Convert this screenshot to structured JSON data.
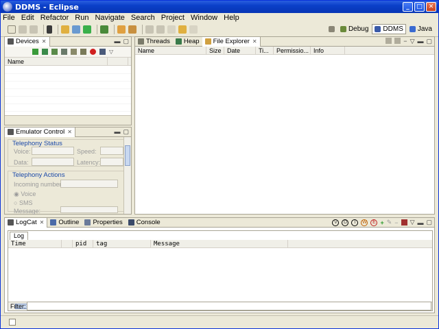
{
  "window": {
    "title": "DDMS - Eclipse"
  },
  "menu": [
    "File",
    "Edit",
    "Refactor",
    "Run",
    "Navigate",
    "Search",
    "Project",
    "Window",
    "Help"
  ],
  "perspectives": [
    {
      "label": "Debug",
      "active": false
    },
    {
      "label": "DDMS",
      "active": true
    },
    {
      "label": "Java",
      "active": false
    }
  ],
  "devices": {
    "tab": "Devices",
    "column": "Name"
  },
  "emulator": {
    "tab": "Emulator Control",
    "telephony_status": "Telephony Status",
    "voice_label": "Voice:",
    "speed_label": "Speed:",
    "data_label": "Data:",
    "latency_label": "Latency:",
    "telephony_actions": "Telephony Actions",
    "incoming_label": "Incoming number:",
    "voice_option": "Voice",
    "sms_option": "SMS",
    "message_label": "Message:"
  },
  "explorer": {
    "tabs": [
      "Threads",
      "Heap",
      "File Explorer"
    ],
    "columns": [
      "Name",
      "Size",
      "Date",
      "Ti...",
      "Permissio...",
      "Info"
    ]
  },
  "bottom": {
    "tabs": [
      "LogCat",
      "Outline",
      "Properties",
      "Console"
    ],
    "level_buttons": [
      "V",
      "D",
      "I",
      "W",
      "E"
    ],
    "log_tab": "Log",
    "columns": [
      "Time",
      "",
      "pid",
      "tag",
      "Message"
    ],
    "filter_label": "Filter:",
    "filter_value": ""
  }
}
